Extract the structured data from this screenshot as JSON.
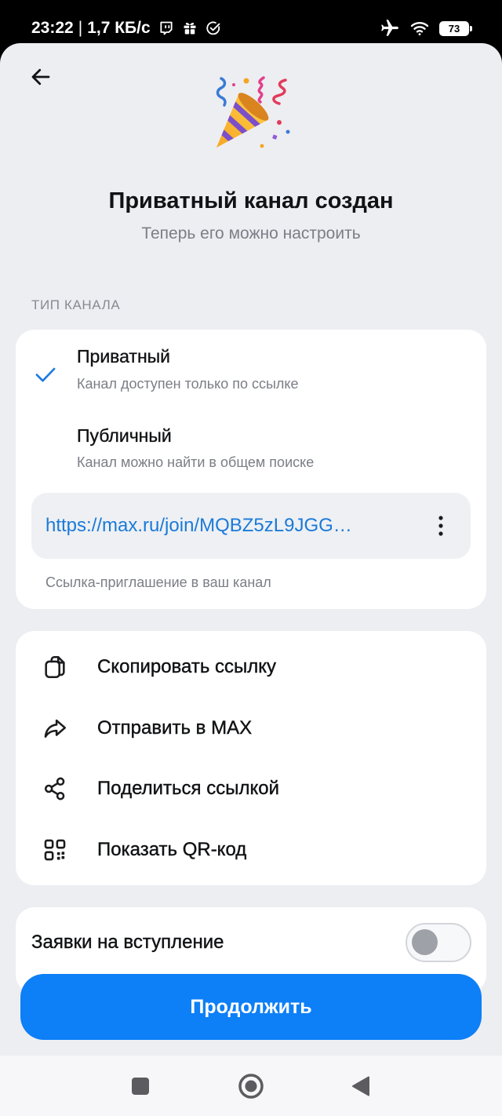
{
  "status_bar": {
    "time": "23:22",
    "separator": "|",
    "network_speed": "1,7 КБ/с",
    "left_icons": [
      "twitch-icon",
      "gift-icon",
      "check-circle-icon"
    ],
    "right_icons": [
      "airplane-icon",
      "wifi-icon",
      "battery-icon"
    ],
    "battery": "73"
  },
  "header": {
    "back_icon": "arrow-left-icon",
    "illustration": "party-popper-icon",
    "title": "Приватный канал создан",
    "subtitle": "Теперь его можно настроить"
  },
  "channel_type": {
    "section_label": "ТИП КАНАЛА",
    "options": [
      {
        "title": "Приватный",
        "description": "Канал доступен только по ссылке",
        "selected": true
      },
      {
        "title": "Публичный",
        "description": "Канал можно найти в общем поиске",
        "selected": false
      }
    ],
    "invite_link": "https://max.ru/join/MQBZ5zL9JGG…",
    "invite_hint": "Ссылка-приглашение в ваш канал"
  },
  "actions": [
    {
      "icon": "copy-icon",
      "label": "Скопировать ссылку"
    },
    {
      "icon": "forward-icon",
      "label": "Отправить в MAX"
    },
    {
      "icon": "share-icon",
      "label": "Поделиться ссылкой"
    },
    {
      "icon": "qr-code-icon",
      "label": "Показать QR-код"
    }
  ],
  "join_requests": {
    "label": "Заявки на вступление",
    "enabled": false
  },
  "continue_button": {
    "label": "Продолжить"
  },
  "nav_bar": {
    "icons": [
      "recents-icon",
      "home-icon",
      "back-icon"
    ]
  },
  "colors": {
    "accent": "#0d7ff7",
    "link": "#1a7ad9",
    "sheet_background": "#edeef2",
    "card_background": "#ffffff",
    "secondary_text": "#7b7e86"
  }
}
